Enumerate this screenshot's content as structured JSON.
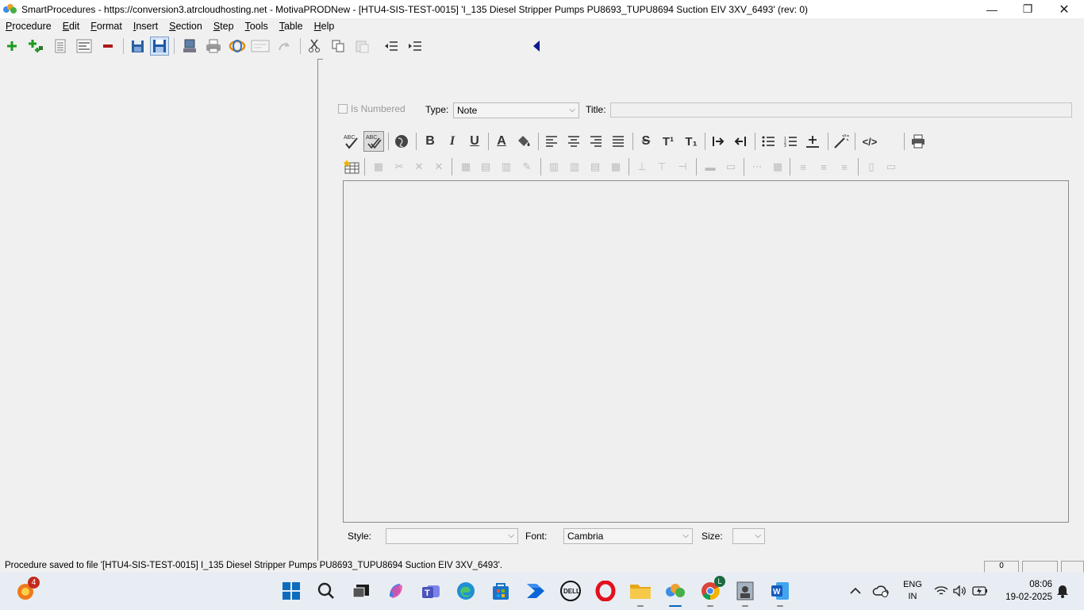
{
  "window": {
    "title": "SmartProcedures - https://conversion3.atrcloudhosting.net - MotivaPRODNew - [HTU4-SIS-TEST-0015] 'I_135 Diesel Stripper Pumps PU8693_TUPU8694 Suction EIV 3XV_6493' (rev: 0)",
    "minimize": "—",
    "maximize": "❐",
    "close": "✕"
  },
  "menu": [
    "Procedure",
    "Edit",
    "Format",
    "Insert",
    "Section",
    "Step",
    "Tools",
    "Table",
    "Help"
  ],
  "properties": {
    "is_numbered_label": "Is Numbered",
    "type_label": "Type:",
    "type_value": "Note",
    "title_label": "Title:",
    "title_value": ""
  },
  "format_toolbar": {
    "bold": "B",
    "italic": "I",
    "underline": "U",
    "font_color": "A",
    "strike": "S",
    "superscript": "T¹",
    "subscript": "T₁",
    "html": "</>",
    "spell_check": "ABC",
    "spell_auto": "ABC"
  },
  "bottom": {
    "style_label": "Style:",
    "style_value": "",
    "font_label": "Font:",
    "font_value": "Cambria",
    "size_label": "Size:",
    "size_value": ""
  },
  "status": {
    "message": "Procedure saved to file '[HTU4-SIS-TEST-0015] I_135 Diesel Stripper Pumps PU8693_TUPU8694 Suction EIV 3XV_6493'.",
    "cell1": "0"
  },
  "taskbar": {
    "notification_badge": "4",
    "chrome_badge": "L",
    "lang_line1": "ENG",
    "lang_line2": "IN",
    "time": "08:06",
    "date": "19-02-2025"
  }
}
